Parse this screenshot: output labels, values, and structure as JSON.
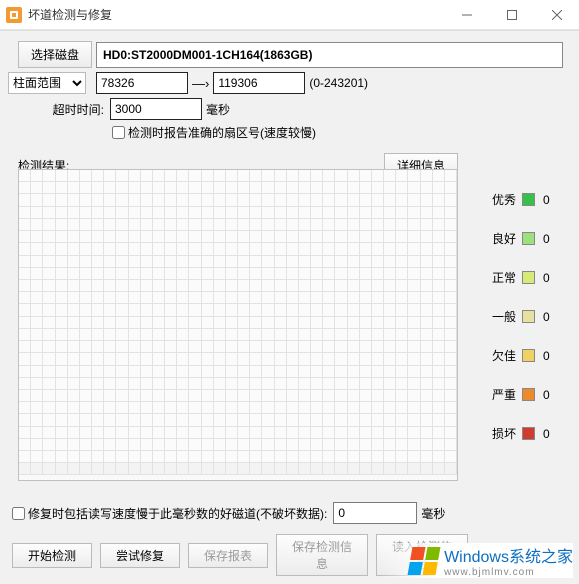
{
  "window": {
    "title": "坏道检测与修复"
  },
  "disk": {
    "select_button": "选择磁盘",
    "label": "HD0:ST2000DM001-1CH164(1863GB)"
  },
  "range": {
    "label": "柱面范围",
    "from": "78326",
    "to": "119306",
    "limits": "(0-243201)"
  },
  "timeout": {
    "label": "超时时间:",
    "value": "3000",
    "unit": "毫秒"
  },
  "accurate": {
    "label": "检测时报告准确的扇区号(速度较慢)"
  },
  "results": {
    "label": "检测结果:",
    "details_button": "详细信息"
  },
  "legend": [
    {
      "name": "优秀",
      "color": "#36c24a",
      "count": "0"
    },
    {
      "name": "良好",
      "color": "#9ee07d",
      "count": "0"
    },
    {
      "name": "正常",
      "color": "#d7ea78",
      "count": "0"
    },
    {
      "name": "一般",
      "color": "#e8e0a0",
      "count": "0"
    },
    {
      "name": "欠佳",
      "color": "#f2d163",
      "count": "0"
    },
    {
      "name": "严重",
      "color": "#eb8b2d",
      "count": "0"
    },
    {
      "name": "损坏",
      "color": "#d13a2f",
      "count": "0"
    }
  ],
  "repair": {
    "option_label": "修复时包括读写速度慢于此毫秒数的好磁道(不破坏数据):",
    "threshold": "0",
    "threshold_unit": "毫秒"
  },
  "buttons": {
    "start": "开始检测",
    "try_repair": "尝试修复",
    "save_report": "保存报表",
    "save_info": "保存检测信息",
    "load_info": "读入检测信息"
  },
  "watermark": {
    "text": "Windows系统之家",
    "url": "www.bjmlmv.com"
  }
}
